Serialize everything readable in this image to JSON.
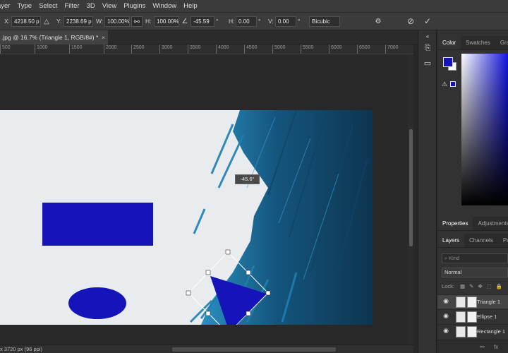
{
  "menu": [
    "ayer",
    "Type",
    "Select",
    "Filter",
    "3D",
    "View",
    "Plugins",
    "Window",
    "Help"
  ],
  "options": {
    "x_label": "X:",
    "x_value": "4218.50 p",
    "y_label": "Y:",
    "y_value": "2238.69 p",
    "w_label": "W:",
    "w_value": "100.00%",
    "h_label": "H:",
    "h_value": "100.00%",
    "angle_value": "-45.59",
    "degree": "°",
    "hskew_label": "H:",
    "hskew_value": "0.00",
    "vskew_label": "V:",
    "vskew_value": "0.00",
    "interpolation": "Bicubic"
  },
  "document_tab": {
    "title": ".jpg @ 16.7% (Triangle 1, RGB/8#) *",
    "close": "×"
  },
  "ruler_ticks": [
    "500",
    "1000",
    "1500",
    "2000",
    "2500",
    "3000",
    "3500",
    "4000",
    "4500",
    "5000",
    "5500",
    "6000",
    "6500",
    "7000"
  ],
  "rotation_tooltip": "-45.6°",
  "status": "x 3720 px (96 ppi)",
  "panels": {
    "color_tabs": [
      "Color",
      "Swatches",
      "Grad"
    ],
    "color_active": "Color",
    "properties_tabs": [
      "Properties",
      "Adjustments"
    ],
    "properties_active": "Properties",
    "layers_tabs": [
      "Layers",
      "Channels",
      "Path"
    ],
    "layers_active": "Layers",
    "search_placeholder": "Kind",
    "blend_mode": "Normal",
    "lock_label": "Lock:",
    "layers": [
      {
        "name": "Triangle 1",
        "selected": true
      },
      {
        "name": "Ellipse 1",
        "selected": false
      },
      {
        "name": "Rectangle 1",
        "selected": false
      }
    ],
    "footer": [
      "fx"
    ]
  },
  "colors": {
    "shape_blue": "#1414b8",
    "paint_blue": "#1b6e9a",
    "ui_bg": "#323232"
  }
}
